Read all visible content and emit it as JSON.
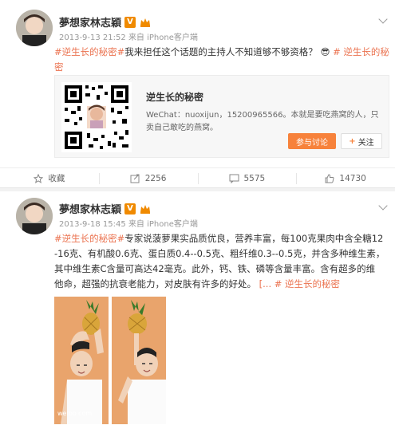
{
  "post1": {
    "author": "夢想家林志穎",
    "verified_badge": "V",
    "timestamp": "2013-9-13 21:52",
    "source": "来自 iPhone客户端",
    "text_tag": "#逆生长的秘密#",
    "text_body": "我来担任这个话题的主持人不知道够不够资格？",
    "text_emoji": "😎",
    "text_tail_tag": "# 逆生长的秘密",
    "share_card": {
      "title": "逆生长的秘密",
      "desc": "WeChat：nuoxijun，15200965566。本就是要吃燕窝的人，只卖自己敢吃的燕窝。",
      "discuss_label": "参与讨论",
      "follow_label": "关注",
      "follow_icon": "plus"
    },
    "actions": {
      "favorite_label": "收藏",
      "repost_count": "2256",
      "comment_count": "5575",
      "like_count": "14730"
    }
  },
  "post2": {
    "author": "夢想家林志穎",
    "verified_badge": "V",
    "timestamp": "2013-9-18 15:45",
    "source": "来自 iPhone客户端",
    "text_tag": "#逆生长的秘密#",
    "text_line1": "专家说菠萝果实品质优良，营养丰富，每100克果肉中含全糖12",
    "text_line2": "-16克、有机酸0.6克、蛋白质0.4--0.5克、粗纤维0.3--0.5克，并含多种维生素，",
    "text_line3": "其中维生素C含量可高达42毫克。此外，钙、铁、磷等含量丰富。含有超多的维",
    "text_line4_a": "他命，超强的抗衰老能力，对皮肤有许多的好处。",
    "text_more": "[...",
    "text_tail_tag": "# 逆生长的秘密",
    "watermark": "weibo.com"
  },
  "colors": {
    "accent": "#eb7350",
    "discuss_button": "#f7823b",
    "badge": "#f08a00"
  }
}
